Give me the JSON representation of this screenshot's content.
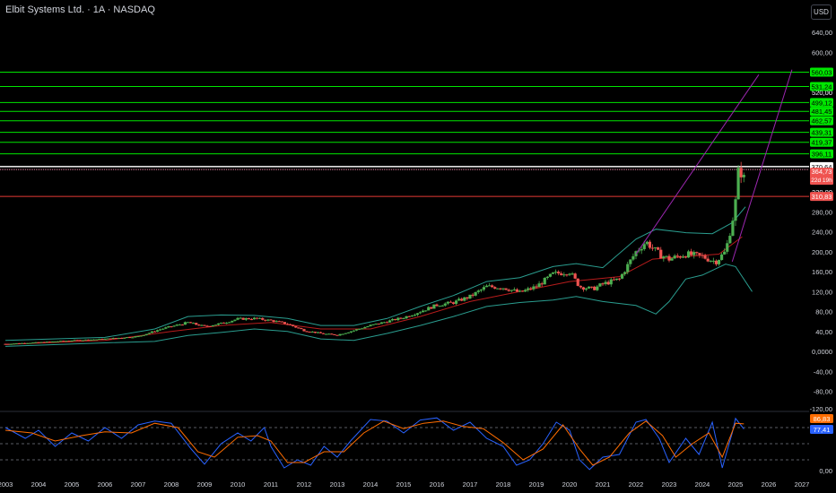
{
  "header": {
    "title": "Elbit Systems Ltd. · 1A · NASDAQ",
    "currency_button": "USD"
  },
  "colors": {
    "background": "#000000",
    "up": "#26a69a",
    "up_candle": "#4caf50",
    "down_candle": "#ef5350",
    "green_line": "#00e600",
    "green_label": "#00e600",
    "red_line": "#e53935",
    "pink_line": "#c2185b",
    "bb_band": "#2a9d8f",
    "ma_line": "#b71c1c",
    "trend_line": "#9c27b0",
    "k_line": "#2962ff",
    "d_line": "#ff6d00",
    "text": "#d1d4dc"
  },
  "chart_data": [
    {
      "type": "candlestick",
      "title": "Elbit Systems Ltd. · 1A · NASDAQ",
      "xlim": [
        2003,
        2027
      ],
      "x_ticks": [
        "2003",
        "2004",
        "2005",
        "2006",
        "2007",
        "2008",
        "2009",
        "2010",
        "2011",
        "2012",
        "2013",
        "2014",
        "2015",
        "2016",
        "2017",
        "2018",
        "2019",
        "2020",
        "2021",
        "2022",
        "2023",
        "2024",
        "2025",
        "2026",
        "2027"
      ],
      "ylim": [
        -130,
        700
      ],
      "y_ticks": [
        "640,00",
        "600,00",
        "560,00",
        "520,00",
        "480,00",
        "440,00",
        "400,00",
        "360,00",
        "320,00",
        "280,00",
        "240,00",
        "200,00",
        "160,00",
        "120,00",
        "80,00",
        "40,00",
        "0,0000",
        "-40,00",
        "-80,00",
        "-120,00"
      ],
      "price_path": [
        [
          2003.0,
          15
        ],
        [
          2004.0,
          18
        ],
        [
          2005.0,
          22
        ],
        [
          2006.0,
          25
        ],
        [
          2007.0,
          30
        ],
        [
          2007.7,
          45
        ],
        [
          2008.5,
          58
        ],
        [
          2009.0,
          50
        ],
        [
          2009.5,
          56
        ],
        [
          2010.0,
          65
        ],
        [
          2010.5,
          66
        ],
        [
          2011.0,
          62
        ],
        [
          2011.5,
          55
        ],
        [
          2012.0,
          42
        ],
        [
          2012.6,
          35
        ],
        [
          2013.0,
          33
        ],
        [
          2013.5,
          42
        ],
        [
          2014.0,
          52
        ],
        [
          2014.5,
          60
        ],
        [
          2015.0,
          68
        ],
        [
          2015.5,
          80
        ],
        [
          2016.0,
          93
        ],
        [
          2016.5,
          98
        ],
        [
          2017.0,
          110
        ],
        [
          2017.5,
          130
        ],
        [
          2018.0,
          128
        ],
        [
          2018.5,
          118
        ],
        [
          2019.0,
          130
        ],
        [
          2019.5,
          155
        ],
        [
          2020.0,
          160
        ],
        [
          2020.3,
          130
        ],
        [
          2020.7,
          125
        ],
        [
          2021.0,
          135
        ],
        [
          2021.5,
          145
        ],
        [
          2022.0,
          200
        ],
        [
          2022.3,
          220
        ],
        [
          2022.7,
          195
        ],
        [
          2023.0,
          185
        ],
        [
          2023.5,
          195
        ],
        [
          2024.0,
          190
        ],
        [
          2024.4,
          180
        ],
        [
          2024.7,
          200
        ],
        [
          2024.9,
          260
        ],
        [
          2025.0,
          300
        ],
        [
          2025.1,
          370
        ],
        [
          2025.25,
          346
        ]
      ],
      "bollinger_upper": [
        [
          2003.0,
          22
        ],
        [
          2006.0,
          28
        ],
        [
          2007.5,
          45
        ],
        [
          2008.5,
          70
        ],
        [
          2009.5,
          73
        ],
        [
          2010.5,
          72
        ],
        [
          2011.5,
          66
        ],
        [
          2012.5,
          52
        ],
        [
          2013.5,
          52
        ],
        [
          2014.5,
          66
        ],
        [
          2015.5,
          90
        ],
        [
          2016.5,
          112
        ],
        [
          2017.5,
          140
        ],
        [
          2018.5,
          148
        ],
        [
          2019.5,
          170
        ],
        [
          2020.2,
          176
        ],
        [
          2021.0,
          168
        ],
        [
          2022.0,
          225
        ],
        [
          2022.6,
          245
        ],
        [
          2023.5,
          238
        ],
        [
          2024.3,
          236
        ],
        [
          2024.9,
          258
        ],
        [
          2025.3,
          290
        ]
      ],
      "bollinger_lower": [
        [
          2003.0,
          10
        ],
        [
          2006.0,
          17
        ],
        [
          2007.5,
          20
        ],
        [
          2008.5,
          32
        ],
        [
          2009.5,
          38
        ],
        [
          2010.5,
          45
        ],
        [
          2011.5,
          40
        ],
        [
          2012.5,
          25
        ],
        [
          2013.5,
          22
        ],
        [
          2014.5,
          36
        ],
        [
          2015.5,
          52
        ],
        [
          2016.5,
          70
        ],
        [
          2017.5,
          90
        ],
        [
          2018.5,
          98
        ],
        [
          2019.5,
          103
        ],
        [
          2020.2,
          110
        ],
        [
          2021.0,
          100
        ],
        [
          2022.0,
          92
        ],
        [
          2022.6,
          75
        ],
        [
          2023.0,
          100
        ],
        [
          2023.5,
          145
        ],
        [
          2024.0,
          153
        ],
        [
          2024.7,
          175
        ],
        [
          2025.0,
          170
        ],
        [
          2025.5,
          120
        ]
      ],
      "moving_average": [
        [
          2003.0,
          14
        ],
        [
          2006.0,
          22
        ],
        [
          2008.0,
          40
        ],
        [
          2009.5,
          52
        ],
        [
          2011.0,
          58
        ],
        [
          2012.5,
          45
        ],
        [
          2014.0,
          45
        ],
        [
          2015.5,
          70
        ],
        [
          2017.0,
          100
        ],
        [
          2018.5,
          120
        ],
        [
          2020.0,
          140
        ],
        [
          2021.5,
          150
        ],
        [
          2022.5,
          185
        ],
        [
          2023.5,
          190
        ],
        [
          2024.5,
          195
        ],
        [
          2025.2,
          230
        ]
      ],
      "trend_lines": [
        [
          [
            2022.0,
            195
          ],
          [
            2025.7,
            555
          ]
        ],
        [
          [
            2024.9,
            180
          ],
          [
            2026.7,
            565
          ]
        ]
      ],
      "horizontal_levels": [
        {
          "value": 560.03,
          "label": "560,03",
          "kind": "green"
        },
        {
          "value": 531.24,
          "label": "531,24",
          "kind": "green"
        },
        {
          "value": 499.12,
          "label": "499,12",
          "kind": "green"
        },
        {
          "value": 481.45,
          "label": "481,45",
          "kind": "green"
        },
        {
          "value": 462.57,
          "label": "462,57",
          "kind": "green"
        },
        {
          "value": 439.31,
          "label": "439,31",
          "kind": "green"
        },
        {
          "value": 419.37,
          "label": "419,37",
          "kind": "green"
        },
        {
          "value": 396.11,
          "label": "396,11",
          "kind": "green"
        },
        {
          "value": 370.64,
          "label": "370,64",
          "kind": "white"
        },
        {
          "value": 310.83,
          "label": "310,83",
          "kind": "red"
        }
      ],
      "current_price": {
        "value": 364.73,
        "label": "364,73",
        "countdown": "22d 19h"
      },
      "hidden_partial_labels": {
        "under_531": "520,00",
        "under_310": "320,00"
      }
    },
    {
      "type": "line",
      "panel": "oscillator",
      "ylim": [
        0,
        100
      ],
      "y_ticks": [
        "0,00"
      ],
      "top_tick_partial": "-120,00",
      "levels": [
        80,
        50,
        20
      ],
      "series": [
        {
          "name": "",
          "color": "#2962ff",
          "label": "77,41",
          "values": [
            [
              2003.0,
              80
            ],
            [
              2003.6,
              60
            ],
            [
              2004.0,
              75
            ],
            [
              2004.5,
              45
            ],
            [
              2005.0,
              70
            ],
            [
              2005.5,
              55
            ],
            [
              2006.0,
              80
            ],
            [
              2006.5,
              60
            ],
            [
              2007.0,
              85
            ],
            [
              2007.5,
              92
            ],
            [
              2008.0,
              88
            ],
            [
              2008.6,
              40
            ],
            [
              2009.0,
              12
            ],
            [
              2009.5,
              50
            ],
            [
              2010.0,
              70
            ],
            [
              2010.4,
              55
            ],
            [
              2010.8,
              80
            ],
            [
              2011.0,
              45
            ],
            [
              2011.4,
              5
            ],
            [
              2011.8,
              20
            ],
            [
              2012.2,
              10
            ],
            [
              2012.6,
              45
            ],
            [
              2013.0,
              25
            ],
            [
              2013.4,
              55
            ],
            [
              2014.0,
              95
            ],
            [
              2014.5,
              92
            ],
            [
              2015.0,
              70
            ],
            [
              2015.5,
              94
            ],
            [
              2016.0,
              98
            ],
            [
              2016.5,
              75
            ],
            [
              2017.0,
              90
            ],
            [
              2017.5,
              60
            ],
            [
              2018.0,
              45
            ],
            [
              2018.4,
              10
            ],
            [
              2018.8,
              20
            ],
            [
              2019.2,
              50
            ],
            [
              2019.6,
              90
            ],
            [
              2020.0,
              75
            ],
            [
              2020.3,
              20
            ],
            [
              2020.6,
              2
            ],
            [
              2021.0,
              25
            ],
            [
              2021.5,
              30
            ],
            [
              2022.0,
              90
            ],
            [
              2022.3,
              95
            ],
            [
              2022.7,
              60
            ],
            [
              2023.0,
              15
            ],
            [
              2023.5,
              60
            ],
            [
              2023.9,
              30
            ],
            [
              2024.3,
              90
            ],
            [
              2024.6,
              5
            ],
            [
              2024.9,
              70
            ],
            [
              2025.0,
              97
            ],
            [
              2025.25,
              77.41
            ]
          ]
        },
        {
          "name": "",
          "color": "#ff6d00",
          "label": "86,83",
          "values": [
            [
              2003.0,
              75
            ],
            [
              2003.8,
              70
            ],
            [
              2004.5,
              55
            ],
            [
              2005.3,
              65
            ],
            [
              2006.0,
              72
            ],
            [
              2006.8,
              70
            ],
            [
              2007.5,
              88
            ],
            [
              2008.2,
              80
            ],
            [
              2008.8,
              35
            ],
            [
              2009.3,
              25
            ],
            [
              2010.0,
              62
            ],
            [
              2010.6,
              65
            ],
            [
              2011.0,
              55
            ],
            [
              2011.5,
              15
            ],
            [
              2012.0,
              15
            ],
            [
              2012.6,
              35
            ],
            [
              2013.2,
              35
            ],
            [
              2013.8,
              70
            ],
            [
              2014.4,
              92
            ],
            [
              2015.0,
              78
            ],
            [
              2015.6,
              88
            ],
            [
              2016.2,
              92
            ],
            [
              2016.8,
              82
            ],
            [
              2017.4,
              78
            ],
            [
              2018.0,
              52
            ],
            [
              2018.6,
              20
            ],
            [
              2019.2,
              40
            ],
            [
              2019.8,
              85
            ],
            [
              2020.3,
              40
            ],
            [
              2020.7,
              10
            ],
            [
              2021.2,
              25
            ],
            [
              2021.8,
              70
            ],
            [
              2022.3,
              92
            ],
            [
              2022.8,
              65
            ],
            [
              2023.2,
              25
            ],
            [
              2023.7,
              50
            ],
            [
              2024.2,
              70
            ],
            [
              2024.6,
              25
            ],
            [
              2025.0,
              88
            ],
            [
              2025.25,
              86.83
            ]
          ]
        }
      ]
    }
  ]
}
